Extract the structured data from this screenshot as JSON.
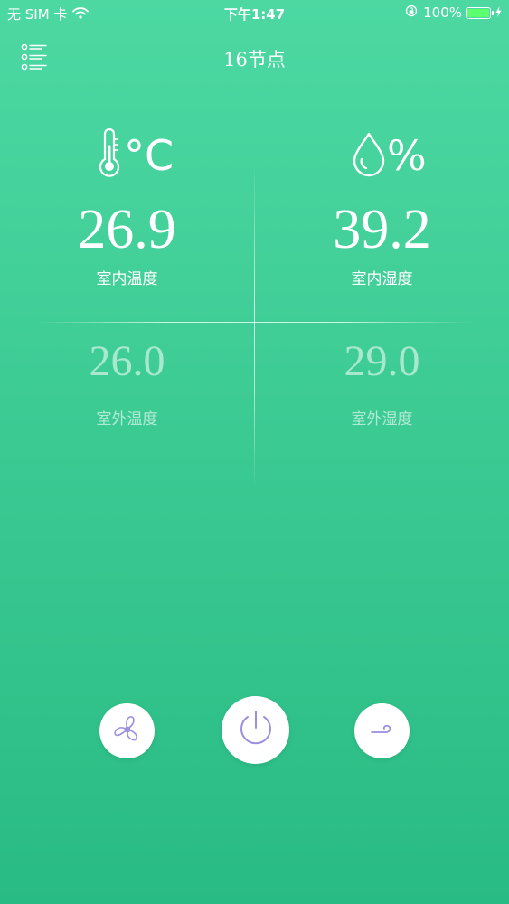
{
  "status_bar": {
    "carrier": "无 SIM 卡",
    "time": "下午1:47",
    "battery_percent": "100%",
    "battery_level": 1.0,
    "battery_color": "#5cff6e",
    "icons": [
      "wifi-icon",
      "rotation-lock-icon",
      "battery-icon",
      "charging-bolt-icon"
    ]
  },
  "nav": {
    "title": "16节点",
    "menu_icon": "list-menu-icon"
  },
  "indoor": {
    "temp_unit": "°C",
    "humidity_unit": "%",
    "temperature": "26.9",
    "temperature_label": "室内温度",
    "humidity": "39.2",
    "humidity_label": "室内湿度"
  },
  "outdoor": {
    "temperature": "26.0",
    "temperature_label": "室外温度",
    "humidity": "29.0",
    "humidity_label": "室外湿度"
  },
  "controls": {
    "fan_icon": "fan-icon",
    "power_icon": "power-icon",
    "swing_icon": "wind-icon",
    "icon_color": "#9b8fe0"
  },
  "theme": {
    "background_top": "#4dd8a2",
    "background_bottom": "#29bb84",
    "text": "#ffffff"
  }
}
